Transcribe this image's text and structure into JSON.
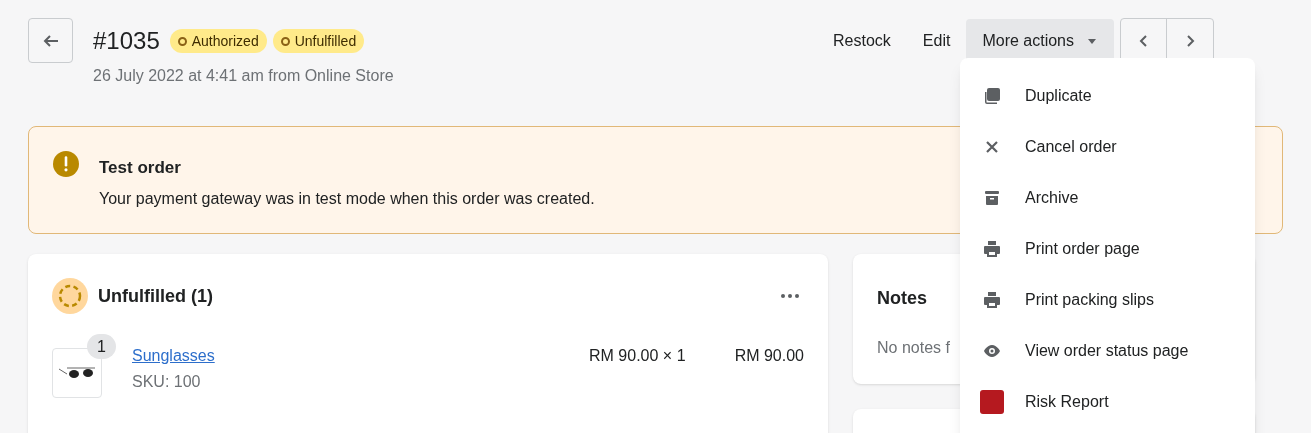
{
  "header": {
    "order_number": "#1035",
    "badges": [
      "Authorized",
      "Unfulfilled"
    ],
    "subtitle": "26 July 2022 at 4:41 am from Online Store"
  },
  "actions": [
    "Restock",
    "Edit"
  ],
  "more_actions": {
    "label": "More actions",
    "expanded": true,
    "items": [
      {
        "kind": "duplicate",
        "label": "Duplicate"
      },
      {
        "kind": "cancel",
        "label": "Cancel order"
      },
      {
        "kind": "archive",
        "label": "Archive"
      },
      {
        "kind": "print",
        "label": "Print order page"
      },
      {
        "kind": "print",
        "label": "Print packing slips"
      },
      {
        "kind": "view",
        "label": "View order status page"
      },
      {
        "kind": "app",
        "label": "Risk Report"
      }
    ]
  },
  "banner": {
    "title": "Test order",
    "message": "Your payment gateway was in test mode when this order was created."
  },
  "fulfillment_card": {
    "title": "Unfulfilled (1)",
    "items": [
      {
        "quantity": "1",
        "name": "Sunglasses",
        "sku": "SKU: 100",
        "unit_price": "RM 90.00 × 1",
        "total": "RM 90.00"
      }
    ]
  },
  "notes_card": {
    "title": "Notes",
    "text": "No notes f"
  }
}
